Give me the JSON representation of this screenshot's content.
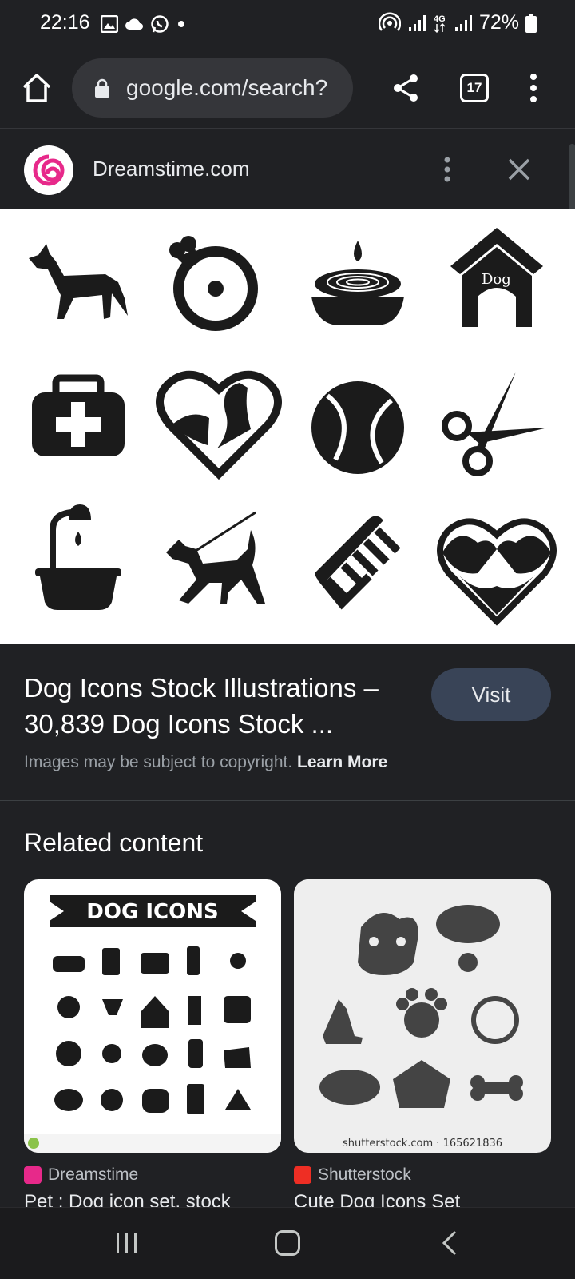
{
  "status_bar": {
    "time": "22:16",
    "battery": "72%"
  },
  "browser": {
    "url": "google.com/search?",
    "tab_count": "17"
  },
  "panel": {
    "site_name": "Dreamstime.com",
    "result_title": "Dog Icons Stock Illustrations – 30,839 Dog Icons Stock ...",
    "visit_label": "Visit",
    "copyright_text": "Images may be subject to copyright.",
    "learn_more": "Learn More",
    "preview_icons": [
      "dog",
      "meat-bone",
      "food-bowl",
      "dog-house",
      "first-aid-kit",
      "heart-woman-dog",
      "tennis-ball",
      "scissors",
      "shower-tub",
      "dog-on-leash",
      "comb",
      "heart-dogs"
    ],
    "preview_doghouse_label": "Dog"
  },
  "related": {
    "title": "Related content",
    "cards": [
      {
        "source": "Dreamstime",
        "caption": "Pet : Dog icon set, stock",
        "banner": "DOG ICONS",
        "source_color": "#e7298a"
      },
      {
        "source": "Shutterstock",
        "caption": "Cute Dog Icons Set",
        "watermark": "shutterstock.com · 165621836",
        "source_color": "#ee2e24"
      }
    ]
  }
}
